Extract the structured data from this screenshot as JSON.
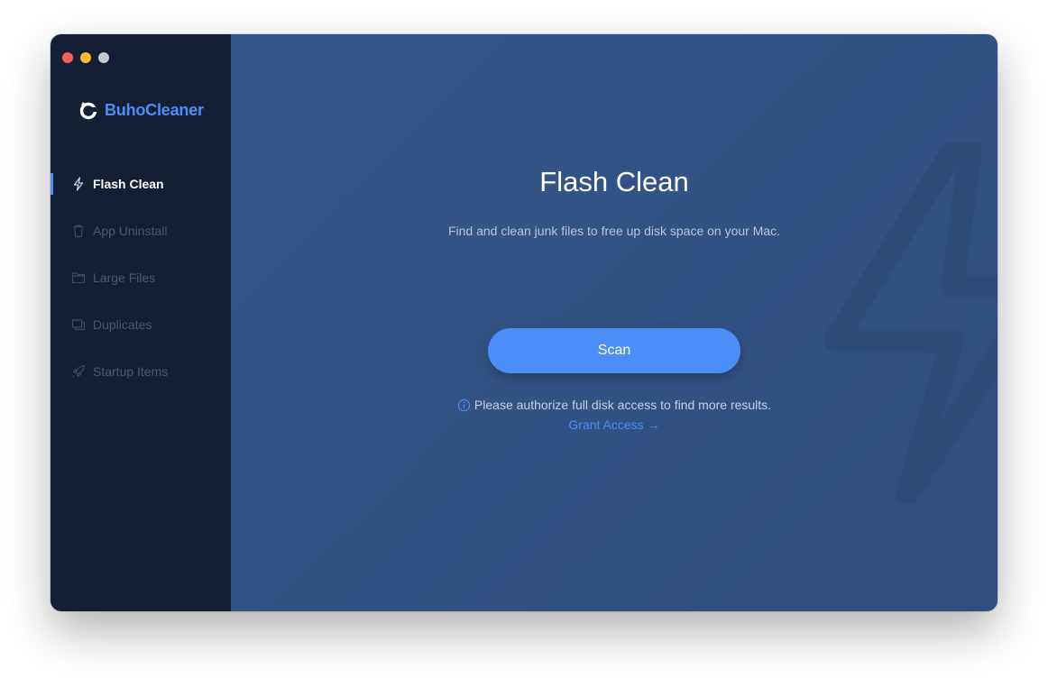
{
  "app": {
    "name": "BuhoCleaner",
    "accent_color": "#4c8ef7"
  },
  "window_controls": [
    "close",
    "minimize",
    "zoom"
  ],
  "sidebar": {
    "items": [
      {
        "label": "Flash Clean",
        "icon": "bolt-icon",
        "active": true
      },
      {
        "label": "App Uninstall",
        "icon": "trash-icon",
        "active": false
      },
      {
        "label": "Large Files",
        "icon": "folder-icon",
        "active": false
      },
      {
        "label": "Duplicates",
        "icon": "duplicates-icon",
        "active": false
      },
      {
        "label": "Startup Items",
        "icon": "rocket-icon",
        "active": false
      }
    ]
  },
  "main": {
    "title": "Flash Clean",
    "subtitle": "Find and clean junk files to free up disk space on your Mac.",
    "scan_label": "Scan",
    "notice": "Please authorize full disk access to find more results.",
    "grant_label": "Grant Access →"
  }
}
